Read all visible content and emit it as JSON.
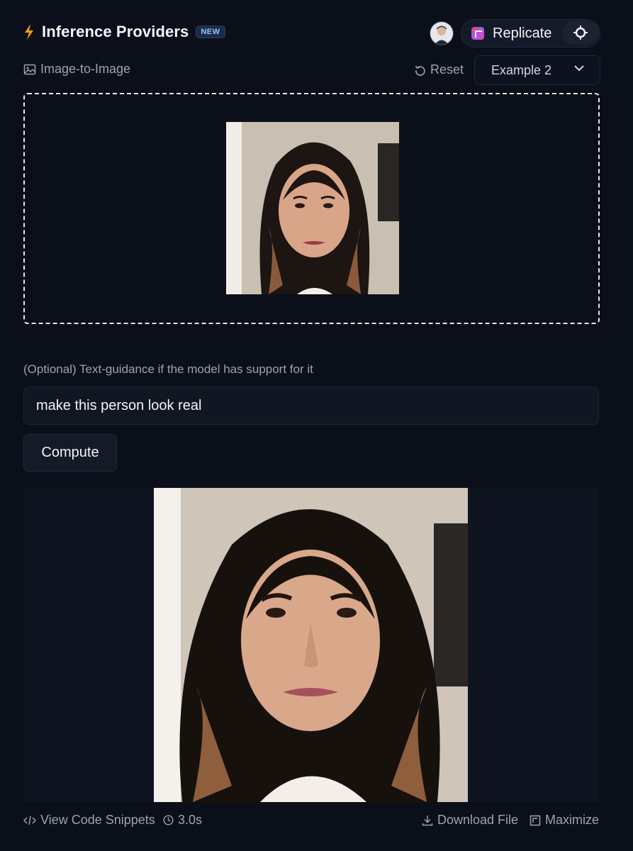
{
  "header": {
    "title": "Inference Providers",
    "badge": "NEW",
    "provider": "Replicate",
    "icons": {
      "bolt": "bolt-icon",
      "avatar": "user-avatar",
      "settings": "gear-icon"
    },
    "colors": {
      "bolt": "#f59e0b",
      "badge_text": "#93c5fd"
    }
  },
  "subbar": {
    "task": "Image-to-Image",
    "reset_label": "Reset",
    "example": "Example 2"
  },
  "guidance": {
    "label": "(Optional) Text-guidance if the model has support for it",
    "value": "make this person look real"
  },
  "actions": {
    "compute_label": "Compute"
  },
  "footer": {
    "code_snippets": "View Code Snippets",
    "duration": "3.0s",
    "download": "Download File",
    "maximize": "Maximize"
  }
}
